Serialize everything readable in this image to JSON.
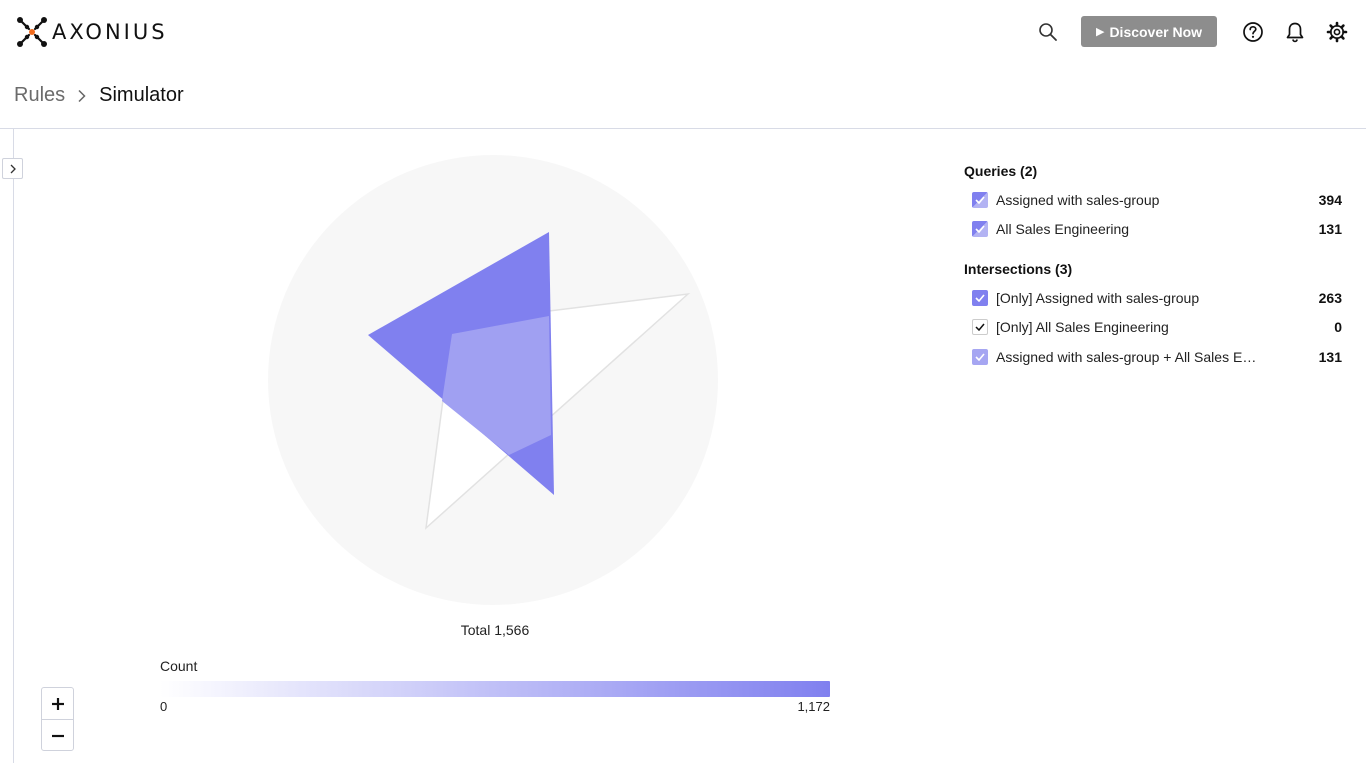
{
  "app": {
    "logo_text": "AXONIUS"
  },
  "header": {
    "discover_label": "Discover Now"
  },
  "breadcrumb": {
    "root": "Rules",
    "current": "Simulator"
  },
  "chart": {
    "total_label": "Total 1,566"
  },
  "legend": {
    "title": "Count",
    "min": "0",
    "max": "1,172",
    "color_low": "#ffffff",
    "color_high": "#8080ef"
  },
  "queries": {
    "title": "Queries (2)",
    "items": [
      {
        "label": "Assigned with sales-group",
        "count": "394"
      },
      {
        "label": "All Sales Engineering",
        "count": "131"
      }
    ]
  },
  "intersections": {
    "title": "Intersections (3)",
    "items": [
      {
        "label": "[Only] Assigned with sales-group",
        "count": "263"
      },
      {
        "label": "[Only] All Sales Engineering",
        "count": "0"
      },
      {
        "label": "Assigned with sales-group + All Sales En...",
        "count": "131"
      }
    ]
  },
  "colors": {
    "accent": "#8080ef",
    "accent_light": "#a0a0f2",
    "button_gray": "#8d8d8d"
  }
}
